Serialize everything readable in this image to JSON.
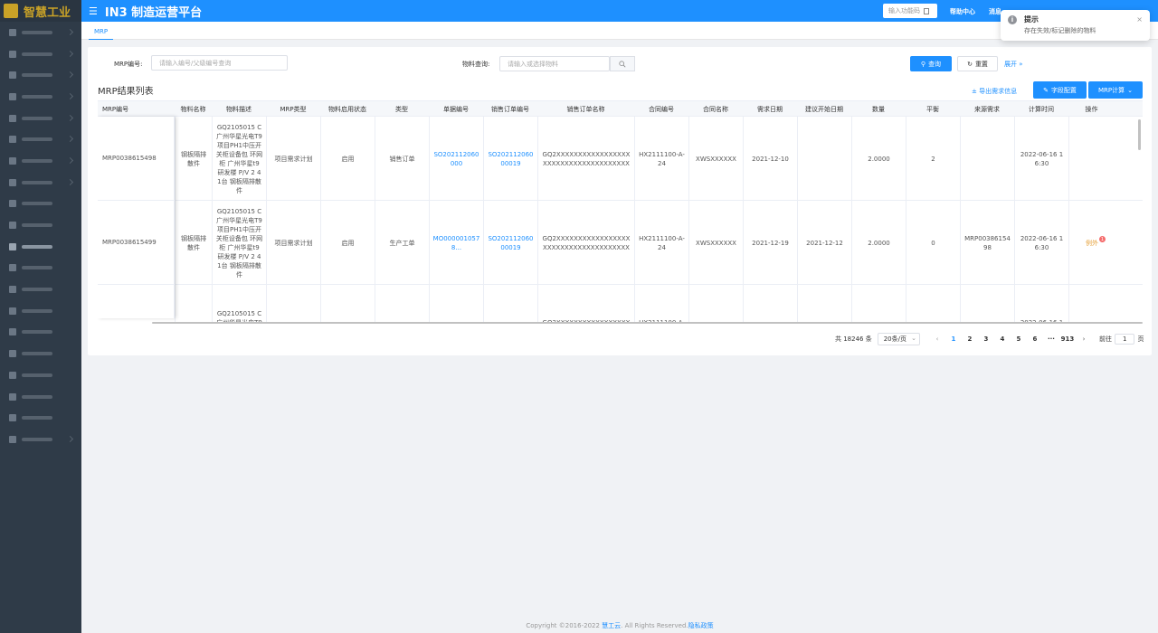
{
  "app": {
    "logo_text": "智慧工业",
    "title": "IN3 制造运营平台",
    "menu_icon": "hamburger-icon"
  },
  "header": {
    "func_input_placeholder": "输入功能码",
    "help_center": "帮助中心",
    "message": "消息"
  },
  "sidebar": {
    "item_count": 20,
    "active_index": 10
  },
  "tabs": [
    {
      "label": "MRP"
    }
  ],
  "filters": {
    "mrp_no_label": "MRP编号:",
    "mrp_no_placeholder": "请输入编号/父级编号查询",
    "material_label": "物料查询:",
    "material_placeholder": "请输入或选择物料",
    "query_button": "查询",
    "reset_button": "重置",
    "expand_link": "展开 »"
  },
  "result": {
    "title": "MRP结果列表",
    "export_link": "导出需求信息",
    "field_config_button": "字段配置",
    "mrp_calc_button": "MRP计算"
  },
  "table": {
    "columns": [
      "MRP编号",
      "物料名称",
      "物料描述",
      "MRP类型",
      "物料启用状态",
      "类型",
      "单据编号",
      "销售订单编号",
      "销售订单名称",
      "合同编号",
      "合同名称",
      "需求日期",
      "建议开始日期",
      "数量",
      "平衡",
      "来源需求",
      "计算时间",
      "操作"
    ],
    "rows": [
      {
        "mrp_no": "MRP0038615498",
        "material_name": "钢板隔排散件",
        "material_desc": "GQ2105015 C 广州华星光电T9 项目PH1中压开关柜设备包 环网柜 广州华星t9 研发楼 P/V 2 4 1台 钢板隔排散件",
        "mrp_type": "项目需求计划",
        "status": "启用",
        "type": "销售订单",
        "doc_no": "SO202112060000",
        "sales_order_no": "SO20211206000019",
        "sales_order_name": "GQ2XXXXXXXXXXXXXXXXXXXXXXXXXXXXXXXXXXXXX",
        "contract_no": "HX2111100-A-24",
        "contract_name": "XWSXXXXXX",
        "demand_date": "2021-12-10",
        "suggest_start": "",
        "qty": "2.0000",
        "balance": "2",
        "source": "",
        "calc_time": "2022-06-16 16:30",
        "op": ""
      },
      {
        "mrp_no": "MRP0038615499",
        "material_name": "钢板隔排散件",
        "material_desc": "GQ2105015 C 广州华星光电T9 项目PH1中压开关柜设备包 环网柜 广州华星t9 研发楼 P/V 2 4 1台 钢板隔排散件",
        "mrp_type": "项目需求计划",
        "status": "启用",
        "type": "生产工单",
        "doc_no": "MO0000010578...",
        "sales_order_no": "SO20211206000019",
        "sales_order_name": "GQ2XXXXXXXXXXXXXXXXXXXXXXXXXXXXXXXXXXXXX",
        "contract_no": "HX2111100-A-24",
        "contract_name": "XWSXXXXXX",
        "demand_date": "2021-12-19",
        "suggest_start": "2021-12-12",
        "qty": "2.0000",
        "balance": "0",
        "source": "MRP0038615498",
        "calc_time": "2022-06-16 16:30",
        "op": "例外"
      },
      {
        "mrp_no": "",
        "material_name": "",
        "material_desc": "GQ2105015 C 广州华星光电T9 项目PH1中压开关柜设备包 环",
        "mrp_type": "",
        "status": "",
        "type": "",
        "doc_no": "",
        "sales_order_no": "",
        "sales_order_name": "GQ2XXXXXXXXXXXXXXXXXXXX",
        "contract_no": "HX2111100-A-1",
        "contract_name": "",
        "demand_date": "",
        "suggest_start": "",
        "qty": "",
        "balance": "",
        "source": "",
        "calc_time": "2022-06-16 18:",
        "op": ""
      }
    ]
  },
  "pagination": {
    "total": "共 18246 条",
    "page_size": "20条/页",
    "pages": [
      "1",
      "2",
      "3",
      "4",
      "5",
      "6",
      "···",
      "913"
    ],
    "current": "1",
    "goto_label": "前往",
    "goto_value": "1",
    "page_unit": "页"
  },
  "toast": {
    "title": "提示",
    "body": "存在失效/标记删除的物料",
    "close": "×"
  },
  "footer": {
    "copyright": "Copyright ©2016-2022",
    "company": "慧工云",
    "rights": ". All Rights Reserved.",
    "privacy": "隐私政策"
  }
}
